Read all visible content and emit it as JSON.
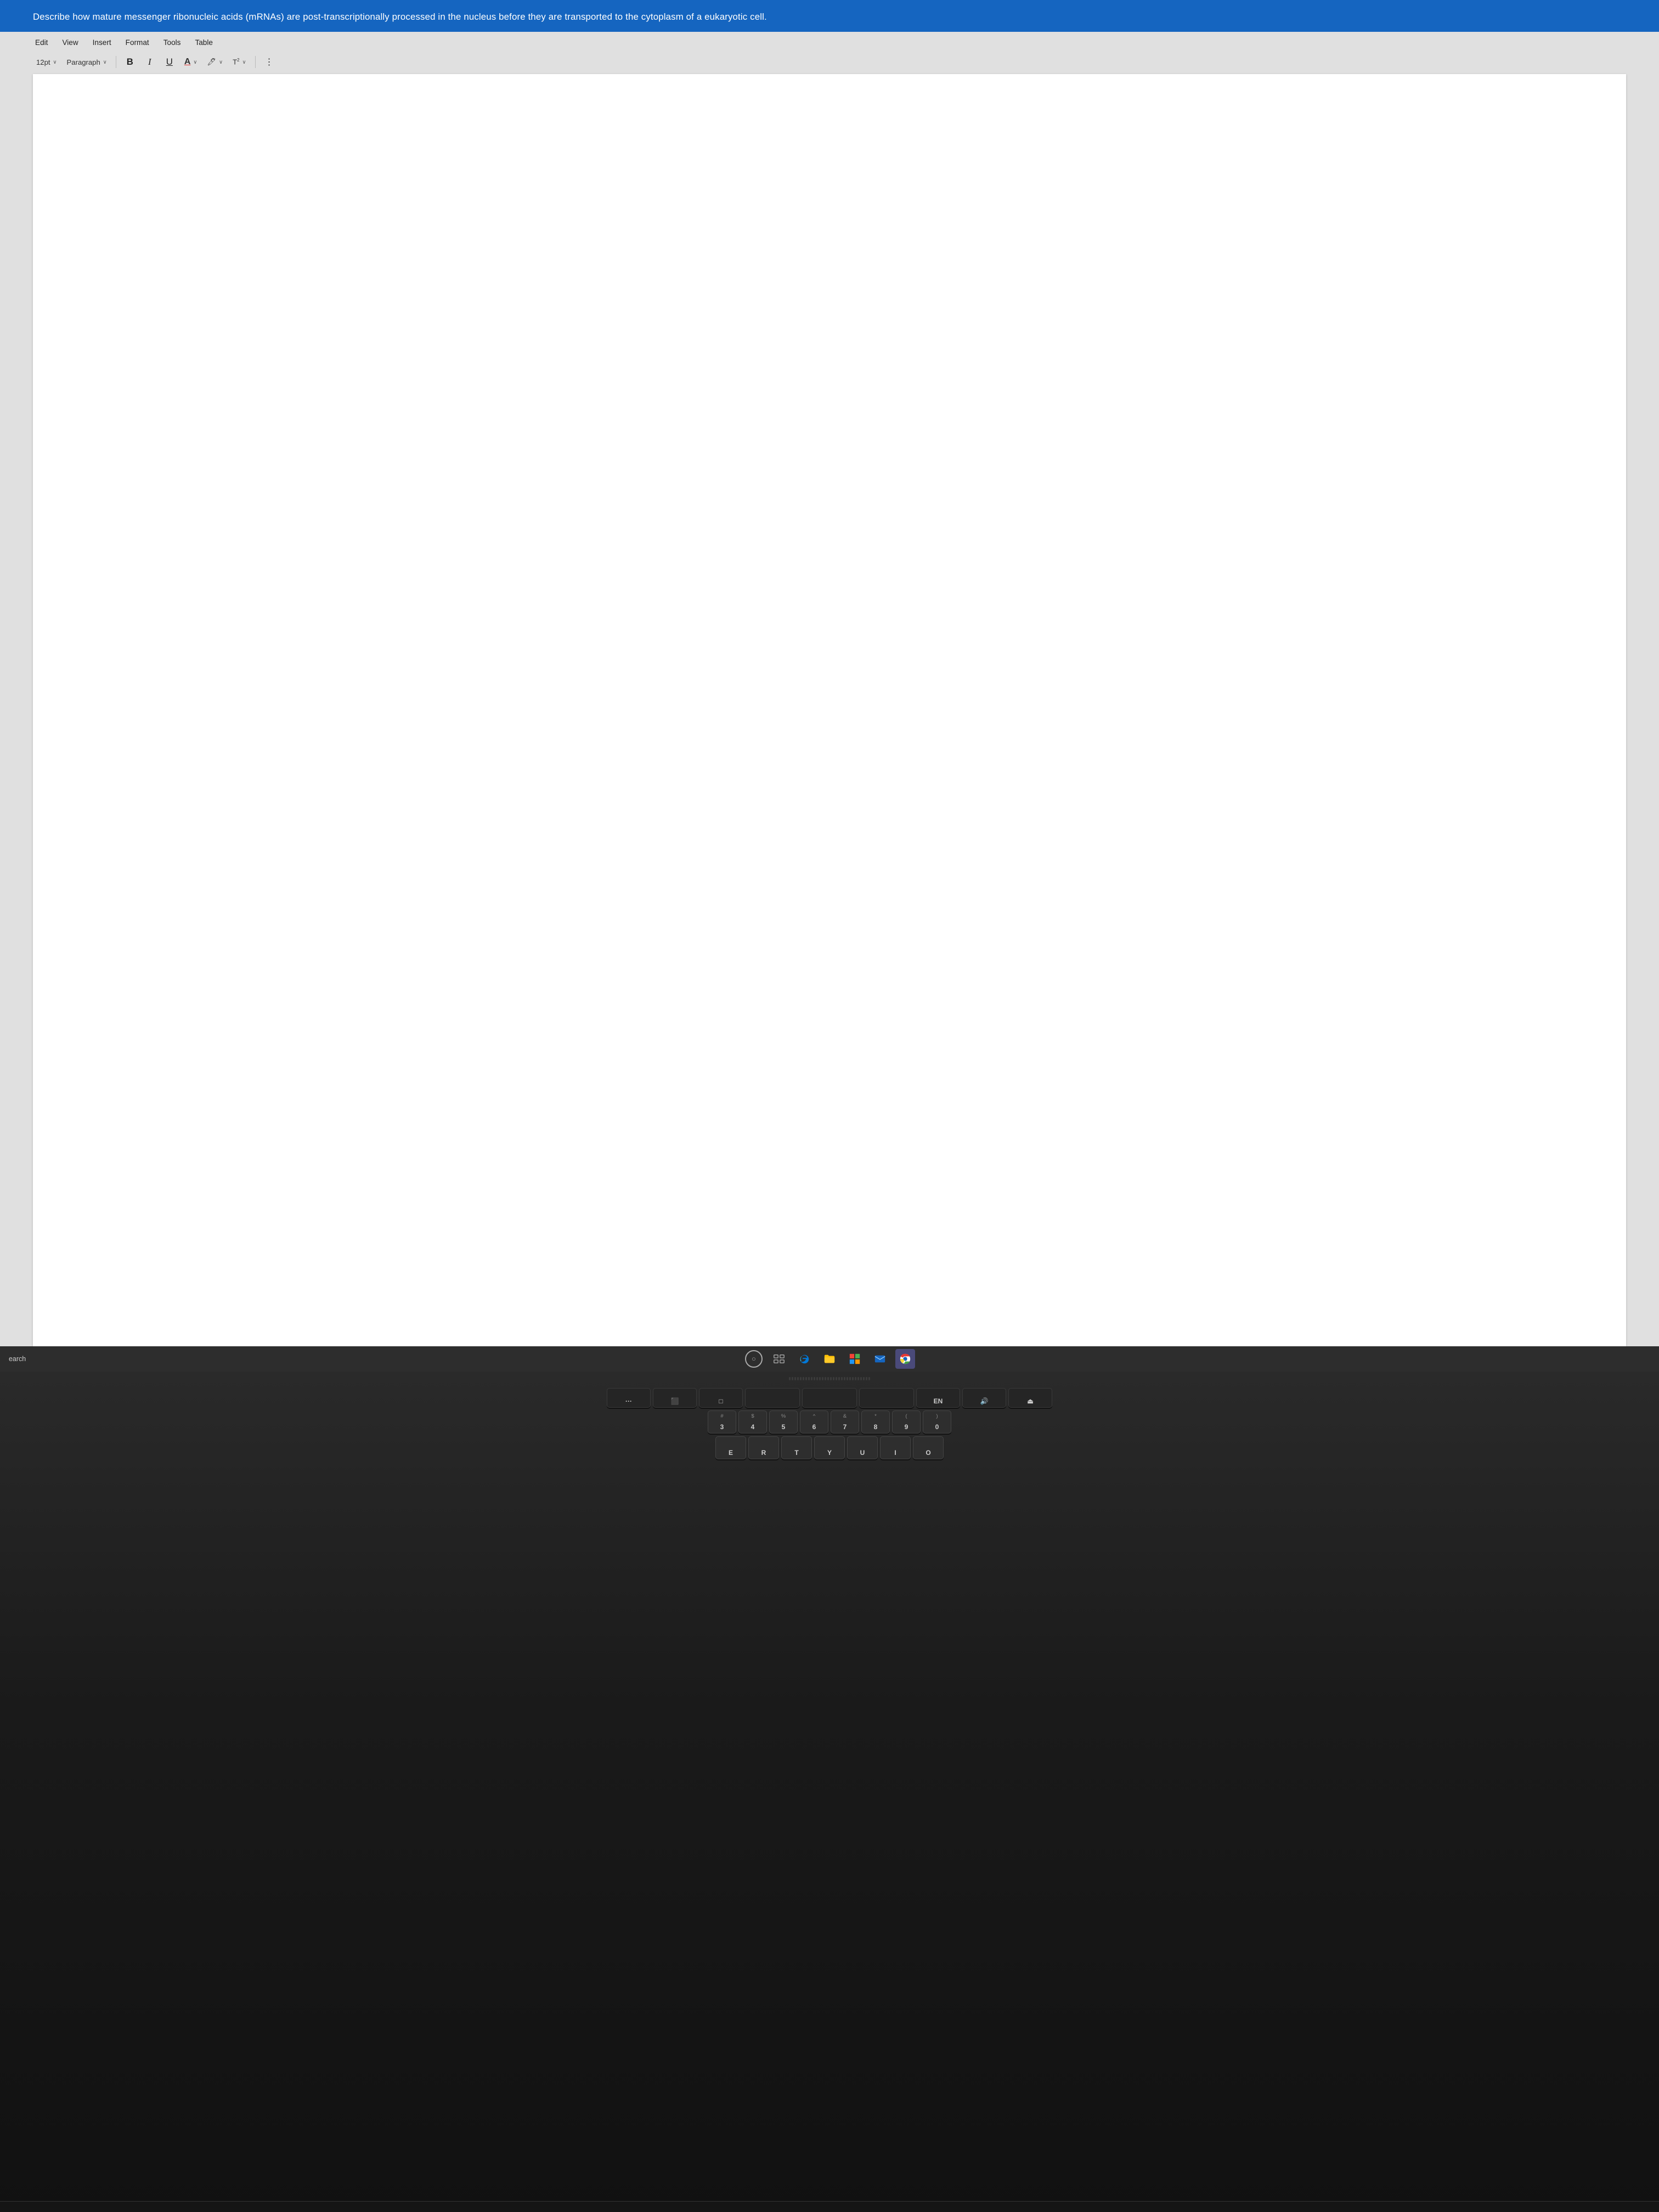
{
  "screen": {
    "question": {
      "text": "Describe how mature messenger ribonucleic acids (mRNAs) are post-transcriptionally processed in the nucleus before they are transported to the cytoplasm of a eukaryotic cell."
    },
    "menu": {
      "items": [
        "Edit",
        "View",
        "Insert",
        "Format",
        "Tools",
        "Table"
      ]
    },
    "toolbar": {
      "font_size": "12pt",
      "font_size_chevron": "∨",
      "paragraph": "Paragraph",
      "paragraph_chevron": "∨",
      "bold": "B",
      "italic": "I",
      "underline": "U",
      "font_color": "A",
      "highlight": "🖊",
      "superscript": "T²",
      "more": "⋮"
    },
    "taskbar": {
      "search_label": "earch",
      "icons": [
        {
          "name": "windows-search",
          "type": "circle"
        },
        {
          "name": "task-view",
          "type": "grid"
        },
        {
          "name": "edge-browser",
          "type": "edge"
        },
        {
          "name": "file-explorer",
          "type": "folder"
        },
        {
          "name": "microsoft-store",
          "type": "store"
        },
        {
          "name": "mail",
          "type": "mail"
        },
        {
          "name": "chrome",
          "type": "chrome",
          "active": true
        }
      ]
    }
  },
  "keyboard": {
    "fn_row": [
      "...",
      "⬛",
      "□",
      "⊞",
      "",
      "",
      "",
      "EN",
      "🔊",
      "⏏"
    ],
    "number_row": [
      {
        "top": "#",
        "main": "3"
      },
      {
        "top": "$",
        "main": "4"
      },
      {
        "top": "%",
        "main": "5"
      },
      {
        "top": "^",
        "main": "6"
      },
      {
        "top": "&",
        "main": "7",
        "top2": "↑"
      },
      {
        "top": "*",
        "main": "8"
      },
      {
        "top": "(",
        "main": "9"
      },
      {
        "top": ")",
        "main": "0"
      }
    ],
    "letter_row": [
      "E",
      "R",
      "T",
      "Y",
      "U",
      "I",
      "O"
    ]
  }
}
